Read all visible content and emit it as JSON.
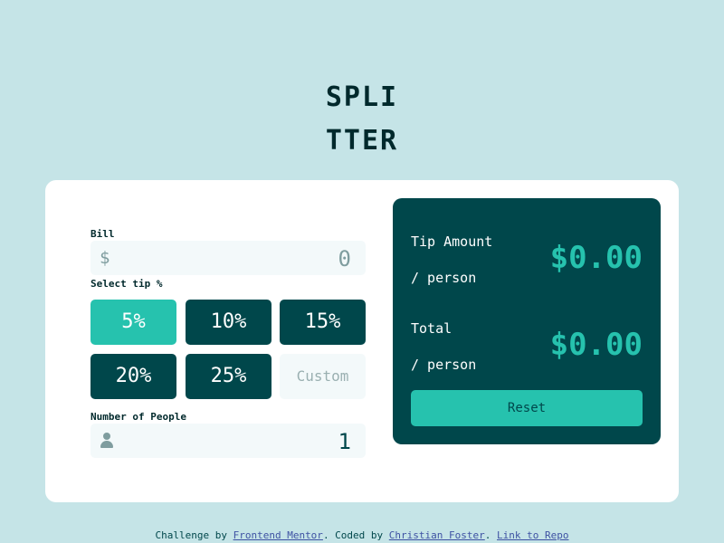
{
  "logo": {
    "line1": "SPLI",
    "line2": "TTER"
  },
  "bill": {
    "label": "Bill",
    "currency_symbol": "$",
    "value": "0"
  },
  "tip": {
    "label": "Select tip %",
    "options": [
      "5%",
      "10%",
      "15%",
      "20%",
      "25%"
    ],
    "selected": "5%",
    "custom_placeholder": "Custom"
  },
  "people": {
    "label": "Number of People",
    "value": "1"
  },
  "result": {
    "tip_amount_label": "Tip Amount",
    "tip_amount_sub": "/ person",
    "tip_amount_value": "$0.00",
    "total_label": "Total",
    "total_sub": "/ person",
    "total_value": "$0.00",
    "reset_label": "Reset"
  },
  "attribution": {
    "prefix": "Challenge by ",
    "link1": "Frontend Mentor",
    "middle": ". Coded by ",
    "link2": "Christian Foster",
    "sep": ". ",
    "link3": "Link to Repo"
  },
  "colors": {
    "background": "#c5e4e7",
    "dark_cyan": "#00474b",
    "strong_cyan": "#26c2ae",
    "input_bg": "#f3f9fa"
  }
}
